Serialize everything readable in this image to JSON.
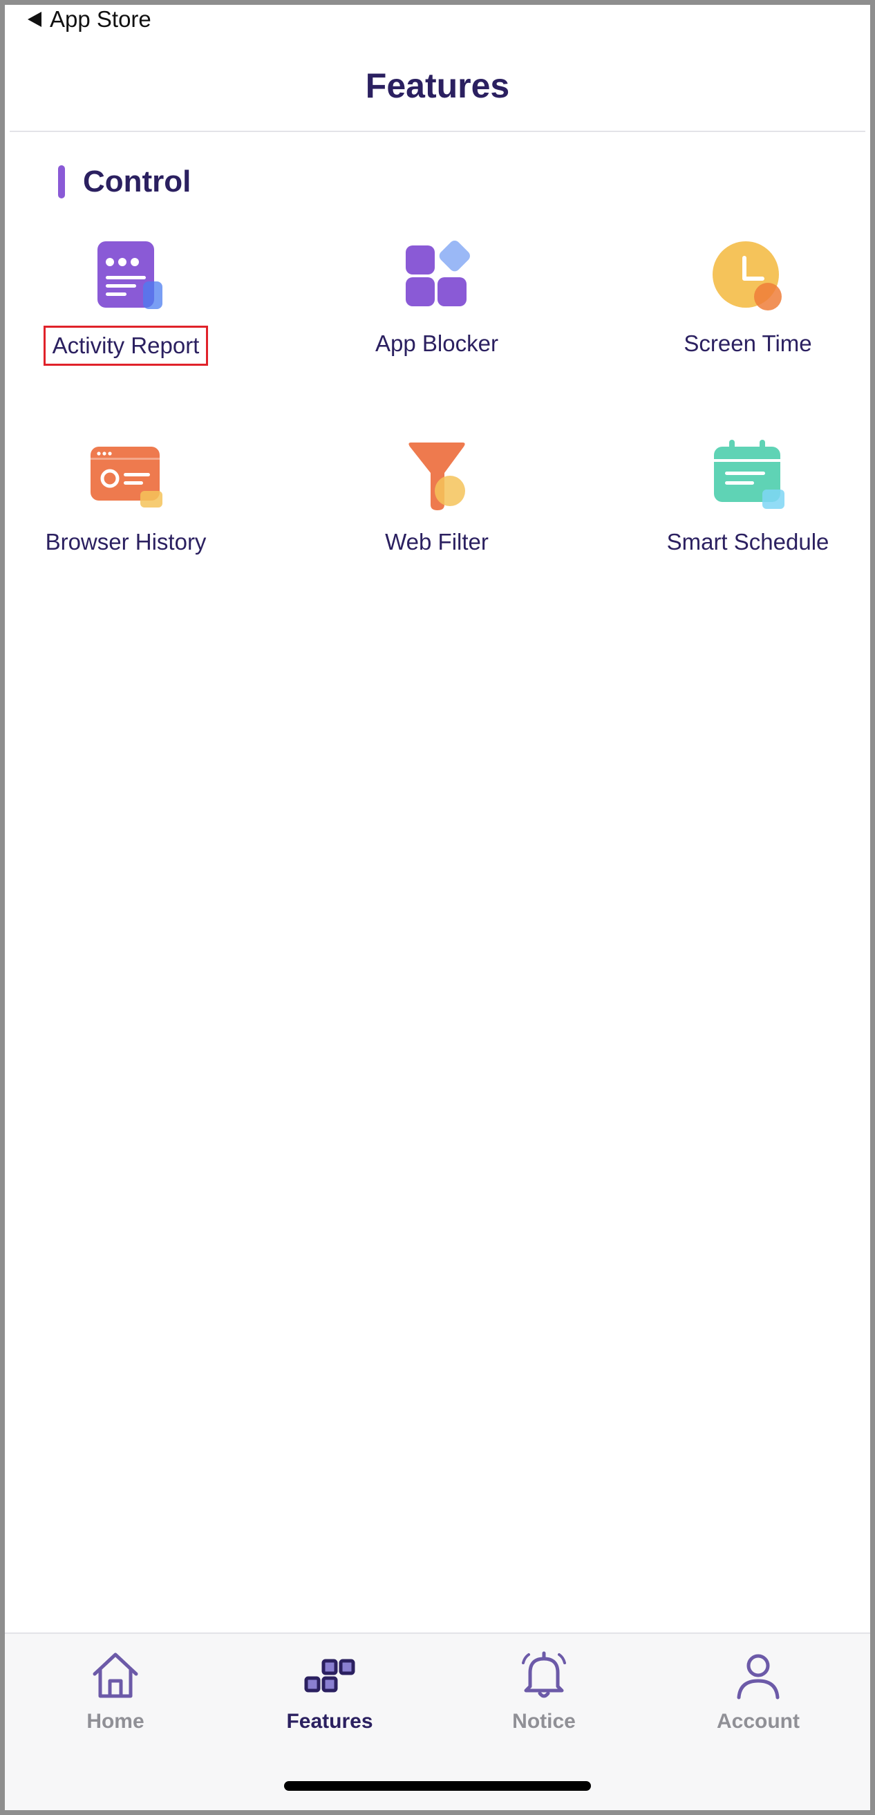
{
  "status_bar": {
    "back_label": "App Store"
  },
  "nav": {
    "title": "Features"
  },
  "section": {
    "title": "Control",
    "accent_color": "#8a5ad6"
  },
  "features": [
    {
      "label": "Activity Report",
      "icon": "activity-report-icon",
      "highlighted": true
    },
    {
      "label": "App Blocker",
      "icon": "app-blocker-icon"
    },
    {
      "label": "Screen Time",
      "icon": "screen-time-icon"
    },
    {
      "label": "Browser History",
      "icon": "browser-history-icon"
    },
    {
      "label": "Web Filter",
      "icon": "web-filter-icon"
    },
    {
      "label": "Smart Schedule",
      "icon": "smart-schedule-icon"
    }
  ],
  "tabbar": {
    "tabs": [
      {
        "label": "Home",
        "icon": "home-icon",
        "active": false
      },
      {
        "label": "Features",
        "icon": "features-icon",
        "active": true
      },
      {
        "label": "Notice",
        "icon": "bell-icon",
        "active": false
      },
      {
        "label": "Account",
        "icon": "person-icon",
        "active": false
      }
    ]
  },
  "colors": {
    "primary_text": "#2b2060",
    "highlight_border": "#e0222a",
    "inactive_tab": "#909096"
  }
}
